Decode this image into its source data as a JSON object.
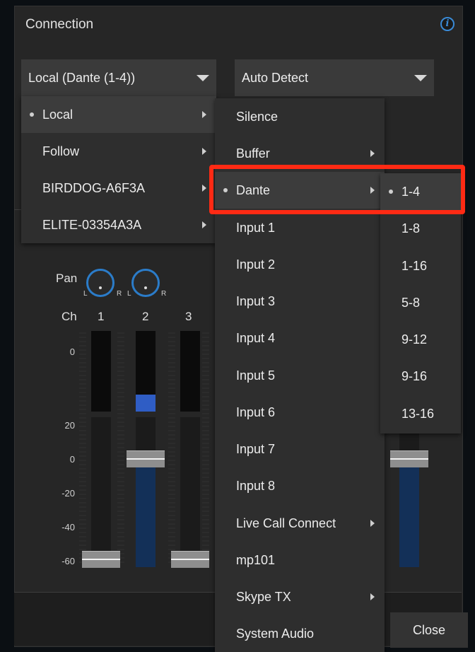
{
  "panel": {
    "title": "Connection",
    "info_icon": "info-icon"
  },
  "source_dropdown": {
    "value": "Local (Dante (1-4))"
  },
  "format_dropdown": {
    "value": "Auto Detect"
  },
  "mixer": {
    "pan_label": "Pan",
    "ch_label": "Ch",
    "channels": [
      "1",
      "2",
      "3"
    ],
    "knob_left": "L",
    "knob_right": "R",
    "top_scale": [
      "0"
    ],
    "bottom_scale": [
      "20",
      "0",
      "-20",
      "-40",
      "-60"
    ]
  },
  "source_menu": {
    "items": [
      {
        "label": "Local",
        "selected": true,
        "submenu": true
      },
      {
        "label": "Follow",
        "selected": false,
        "submenu": true
      },
      {
        "label": "BIRDDOG-A6F3A",
        "selected": false,
        "submenu": true
      },
      {
        "label": "ELITE-03354A3A",
        "selected": false,
        "submenu": true
      }
    ]
  },
  "local_menu": {
    "items": [
      {
        "label": "Silence",
        "submenu": false
      },
      {
        "label": "Buffer",
        "submenu": true
      },
      {
        "label": "Dante",
        "submenu": true,
        "selected": true
      },
      {
        "label": "Input 1",
        "submenu": false
      },
      {
        "label": "Input 2",
        "submenu": false
      },
      {
        "label": "Input 3",
        "submenu": false
      },
      {
        "label": "Input 4",
        "submenu": false
      },
      {
        "label": "Input 5",
        "submenu": false
      },
      {
        "label": "Input 6",
        "submenu": false
      },
      {
        "label": "Input 7",
        "submenu": false
      },
      {
        "label": "Input 8",
        "submenu": false
      },
      {
        "label": "Live Call Connect",
        "submenu": true
      },
      {
        "label": "mp101",
        "submenu": false
      },
      {
        "label": "Skype TX",
        "submenu": true
      },
      {
        "label": "System Audio",
        "submenu": false
      }
    ]
  },
  "dante_menu": {
    "items": [
      {
        "label": "1-4",
        "selected": true
      },
      {
        "label": "1-8",
        "selected": false
      },
      {
        "label": "1-16",
        "selected": false
      },
      {
        "label": "5-8",
        "selected": false
      },
      {
        "label": "9-12",
        "selected": false
      },
      {
        "label": "9-16",
        "selected": false
      },
      {
        "label": "13-16",
        "selected": false
      }
    ]
  },
  "footer": {
    "close_label": "Close"
  },
  "colors": {
    "highlight": "#ff2a14",
    "accent": "#2b7cc9"
  }
}
